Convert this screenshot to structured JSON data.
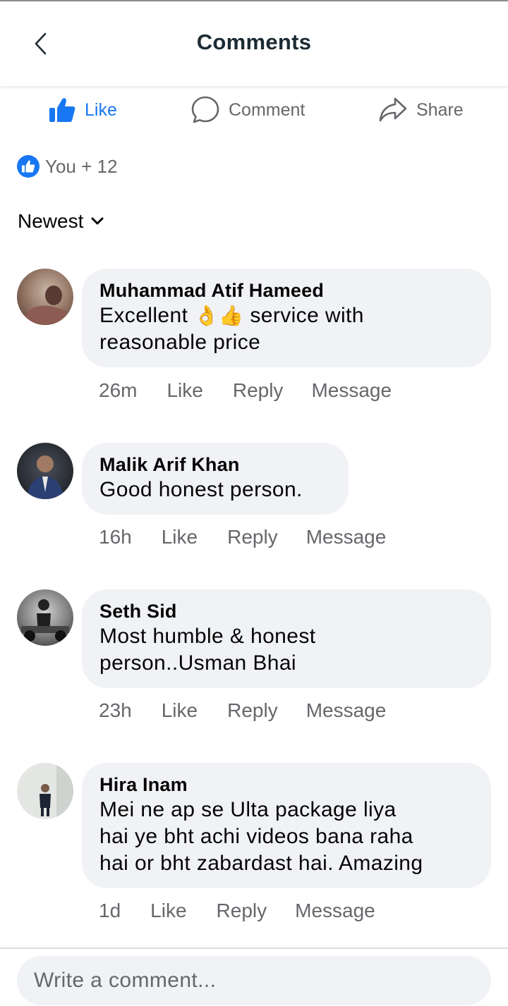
{
  "header": {
    "title": "Comments"
  },
  "actions": {
    "like": "Like",
    "comment": "Comment",
    "share": "Share"
  },
  "reactions": {
    "text": "You + 12"
  },
  "sort": {
    "label": "Newest"
  },
  "comments": [
    {
      "author": "Muhammad Atif Hameed",
      "text_before": "Excellent ",
      "emoji": "👌👍",
      "text_after": " service with\nreasonable price",
      "time": "26m",
      "like": "Like",
      "reply": "Reply",
      "message": "Message"
    },
    {
      "author": "Malik Arif Khan",
      "text": "Good honest person.",
      "time": "16h",
      "like": "Like",
      "reply": "Reply",
      "message": "Message"
    },
    {
      "author": "Seth Sid",
      "text": "Most humble & honest\nperson..Usman Bhai",
      "time": "23h",
      "like": "Like",
      "reply": "Reply",
      "message": "Message"
    },
    {
      "author": "Hira Inam",
      "text": "Mei ne ap se Ulta package liya\nhai ye bht achi videos bana raha\nhai or bht zabardast hai. Amazing",
      "time": "1d",
      "like": "Like",
      "reply": "Reply",
      "message": "Message"
    }
  ],
  "composer": {
    "placeholder": "Write a comment..."
  },
  "colors": {
    "accent": "#1877f2",
    "bubble": "#f0f2f5",
    "muted": "#65676b"
  }
}
